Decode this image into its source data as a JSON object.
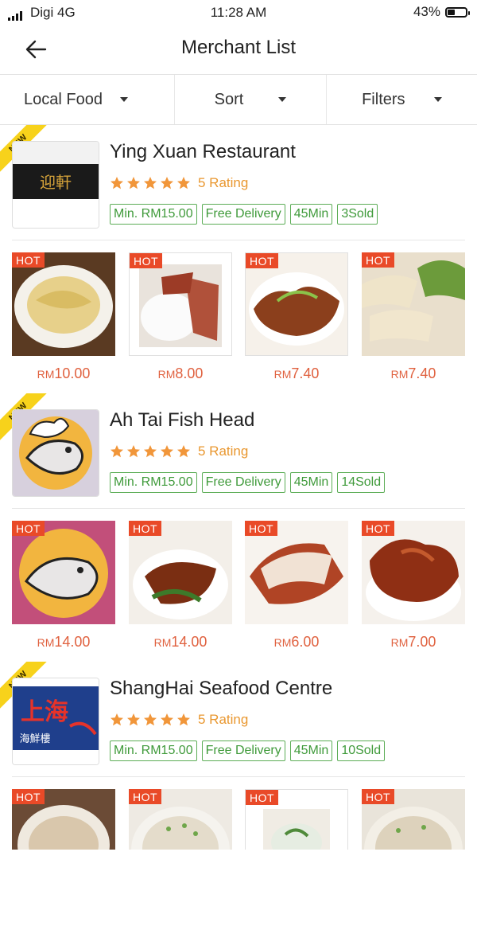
{
  "status": {
    "carrier": "Digi 4G",
    "time": "11:28 AM",
    "battery": "43%",
    "battery_level": 0.43
  },
  "navbar": {
    "title": "Merchant List"
  },
  "filters": [
    {
      "label": "Local Food"
    },
    {
      "label": "Sort"
    },
    {
      "label": "Filters"
    }
  ],
  "colors": {
    "accent": "#e94a28",
    "star": "#f1963a",
    "tag_green": "#3f9a3a",
    "new_ribbon": "#f7d21b",
    "price": "#e0613f"
  },
  "merchants": [
    {
      "name": "Ying Xuan Restaurant",
      "ribbon": "NEW",
      "rating_label": "5 Rating",
      "stars": 5,
      "logo_icon": "restaurant-signboard",
      "logo_text": "迎軒",
      "tags": [
        "Min. RM15.00",
        "Free Delivery",
        "45Min",
        "3Sold"
      ],
      "dishes": [
        {
          "badge": "HOT",
          "currency": "RM",
          "price": "10.00",
          "icon": "steamed-chicken-rice"
        },
        {
          "badge": "HOT",
          "currency": "RM",
          "price": "8.00",
          "icon": "roast-pork-rice"
        },
        {
          "badge": "HOT",
          "currency": "RM",
          "price": "7.40",
          "icon": "roast-duck"
        },
        {
          "badge": "HOT",
          "currency": "RM",
          "price": "7.40",
          "icon": "sliced-chicken"
        }
      ]
    },
    {
      "name": "Ah Tai Fish Head",
      "ribbon": "NEW",
      "rating_label": "5 Rating",
      "stars": 5,
      "logo_icon": "chef-fish-logo",
      "tags": [
        "Min. RM15.00",
        "Free Delivery",
        "45Min",
        "14Sold"
      ],
      "dishes": [
        {
          "badge": "HOT",
          "currency": "RM",
          "price": "14.00",
          "icon": "chef-fish-logo"
        },
        {
          "badge": "HOT",
          "currency": "RM",
          "price": "14.00",
          "icon": "braised-chicken-rice"
        },
        {
          "badge": "HOT",
          "currency": "RM",
          "price": "6.00",
          "icon": "roast-chicken-rice"
        },
        {
          "badge": "HOT",
          "currency": "RM",
          "price": "7.00",
          "icon": "roast-duck-rice"
        }
      ]
    },
    {
      "name": "ShangHai Seafood Centre",
      "ribbon": "NEW",
      "rating_label": "5 Rating",
      "stars": 5,
      "logo_icon": "seafood-signboard",
      "logo_text": "上海",
      "logo_subtext": "海鮮樓",
      "tags": [
        "Min. RM15.00",
        "Free Delivery",
        "45Min",
        "10Sold"
      ],
      "dishes": [
        {
          "badge": "HOT",
          "icon": "porridge-bowl"
        },
        {
          "badge": "HOT",
          "icon": "fish-porridge"
        },
        {
          "badge": "HOT",
          "icon": "soup-bowl"
        },
        {
          "badge": "HOT",
          "icon": "seafood-porridge"
        }
      ]
    }
  ]
}
